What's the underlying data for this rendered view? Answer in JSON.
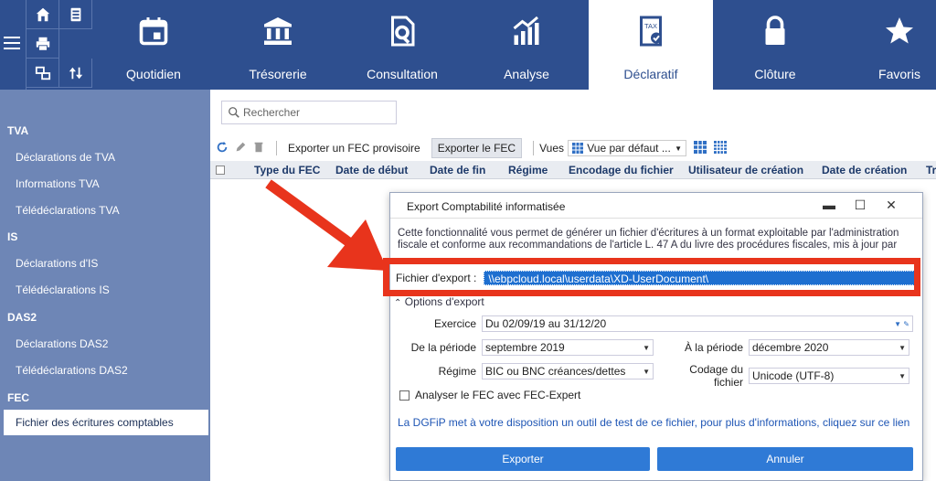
{
  "ribbon": {
    "tabs": [
      {
        "label": "Quotidien",
        "icon": "calendar-icon"
      },
      {
        "label": "Trésorerie",
        "icon": "bank-icon"
      },
      {
        "label": "Consultation",
        "icon": "document-search-icon"
      },
      {
        "label": "Analyse",
        "icon": "bar-chart-icon"
      },
      {
        "label": "Déclaratif",
        "icon": "tax-document-icon",
        "active": true
      },
      {
        "label": "Clôture",
        "icon": "lock-icon"
      },
      {
        "label": "Favoris",
        "icon": "star-icon"
      }
    ],
    "quick_icons": [
      "home-icon",
      "address-book-icon",
      "printer-icon",
      "switch-icon",
      "sort-arrows-icon"
    ],
    "accent": "#2e4f8f"
  },
  "sidebar": {
    "sections": [
      {
        "title": "TVA",
        "items": [
          "Déclarations de TVA",
          "Informations TVA",
          "Télédéclarations TVA"
        ]
      },
      {
        "title": "IS",
        "items": [
          "Déclarations d'IS",
          "Télédéclarations IS"
        ]
      },
      {
        "title": "DAS2",
        "items": [
          "Déclarations DAS2",
          "Télédéclarations DAS2"
        ]
      },
      {
        "title": "FEC",
        "items": [
          "Fichier des écritures comptables"
        ]
      }
    ],
    "selected": "Fichier des écritures comptables"
  },
  "search": {
    "placeholder": "Rechercher"
  },
  "toolbar": {
    "export_provisional": "Exporter un FEC provisoire",
    "export_fec": "Exporter le FEC",
    "views_label": "Vues",
    "view_selected": "Vue par défaut ..."
  },
  "grid": {
    "columns": [
      "Type du FEC",
      "Date de début",
      "Date de fin",
      "Régime",
      "Encodage du fichier",
      "Utilisateur de création",
      "Date de création",
      "Tr"
    ]
  },
  "dialog": {
    "title": "Export Comptabilité informatisée",
    "description": "Cette fonctionnalité vous permet de générer un fichier d'écritures à un format exploitable par l'administration fiscale et conforme aux recommandations de l'article L. 47 A du livre des procédures fiscales, mis à jour par",
    "export_label": "Fichier d'export :",
    "export_value": "\\\\ebpcloud.local\\userdata\\XD-UserDocument\\",
    "options_label": "Options d'export",
    "exercice_label": "Exercice",
    "exercice_value": "Du 02/09/19 au 31/12/20",
    "from_label": "De la période",
    "from_value": "septembre 2019",
    "to_label": "À la période",
    "to_value": "décembre 2020",
    "regime_label": "Régime",
    "regime_value": "BIC ou BNC créances/dettes",
    "encoding_label": "Codage du fichier",
    "encoding_value": "Unicode (UTF-8)",
    "analyse_label": "Analyser le FEC avec FEC-Expert",
    "link_text": "La DGFiP met à votre disposition un outil de test de ce fichier, pour plus d'informations, cliquez sur ce lien",
    "export_button": "Exporter",
    "cancel_button": "Annuler"
  },
  "annotation": {
    "color": "#e8341c"
  }
}
